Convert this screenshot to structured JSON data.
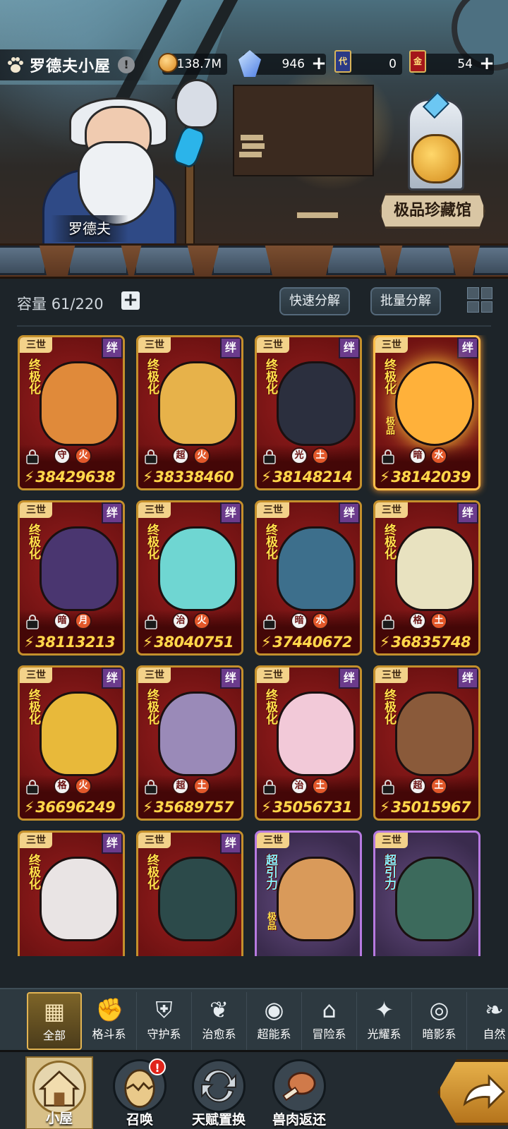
{
  "header": {
    "title": "罗德夫小屋",
    "info_badge": "!",
    "resources": [
      {
        "name": "gold-coin",
        "value": "138.7M",
        "has_plus": false
      },
      {
        "name": "crystal",
        "value": "946",
        "has_plus": true
      },
      {
        "name": "dai-card",
        "icon_text": "代",
        "value": "0",
        "has_plus": false
      },
      {
        "name": "jin-card",
        "icon_text": "金",
        "value": "54",
        "has_plus": true
      }
    ],
    "plus": "+"
  },
  "scene": {
    "npc_name": "罗德夫",
    "collection_label": "极品珍藏馆"
  },
  "inventory": {
    "capacity_label": "容量",
    "capacity_value": "61/220",
    "quick_decompose": "快速分解",
    "batch_decompose": "批量分解"
  },
  "cards": [
    {
      "tier": "三世",
      "bond": "绊",
      "rank": "终极化",
      "quality": "",
      "power": "38429638",
      "el1": "守",
      "el2": "火",
      "art": "#e08a3a",
      "frame": "red"
    },
    {
      "tier": "三世",
      "bond": "绊",
      "rank": "终极化",
      "quality": "",
      "power": "38338460",
      "el1": "超",
      "el2": "火",
      "art": "#e7b24a",
      "frame": "red"
    },
    {
      "tier": "三世",
      "bond": "绊",
      "rank": "终极化",
      "quality": "",
      "power": "38148214",
      "el1": "光",
      "el2": "土",
      "art": "#2b2f3e",
      "frame": "red"
    },
    {
      "tier": "三世",
      "bond": "绊",
      "rank": "终极化",
      "quality": "极品",
      "power": "38142039",
      "el1": "暗",
      "el2": "水",
      "art": "#ffb13a",
      "frame": "gold"
    },
    {
      "tier": "三世",
      "bond": "绊",
      "rank": "终极化",
      "quality": "",
      "power": "38113213",
      "el1": "暗",
      "el2": "月",
      "art": "#4a3670",
      "frame": "red"
    },
    {
      "tier": "三世",
      "bond": "绊",
      "rank": "终极化",
      "quality": "",
      "power": "38040751",
      "el1": "治",
      "el2": "火",
      "art": "#6fd6d2",
      "frame": "red"
    },
    {
      "tier": "三世",
      "bond": "绊",
      "rank": "终极化",
      "quality": "",
      "power": "37440672",
      "el1": "暗",
      "el2": "水",
      "art": "#3d6f8c",
      "frame": "red"
    },
    {
      "tier": "三世",
      "bond": "绊",
      "rank": "终极化",
      "quality": "",
      "power": "36835748",
      "el1": "格",
      "el2": "土",
      "art": "#e8e2c0",
      "frame": "red"
    },
    {
      "tier": "三世",
      "bond": "绊",
      "rank": "终极化",
      "quality": "",
      "power": "36696249",
      "el1": "格",
      "el2": "火",
      "art": "#e8b93a",
      "frame": "red"
    },
    {
      "tier": "三世",
      "bond": "绊",
      "rank": "终极化",
      "quality": "",
      "power": "35689757",
      "el1": "超",
      "el2": "土",
      "art": "#9a8ab8",
      "frame": "red"
    },
    {
      "tier": "三世",
      "bond": "绊",
      "rank": "终极化",
      "quality": "",
      "power": "35056731",
      "el1": "治",
      "el2": "土",
      "art": "#f2c9d8",
      "frame": "red"
    },
    {
      "tier": "三世",
      "bond": "绊",
      "rank": "终极化",
      "quality": "",
      "power": "35015967",
      "el1": "超",
      "el2": "土",
      "art": "#8a5a3a",
      "frame": "red"
    },
    {
      "tier": "三世",
      "bond": "绊",
      "rank": "终极化",
      "quality": "",
      "power": "",
      "el1": "",
      "el2": "",
      "art": "#e9e4e4",
      "frame": "red"
    },
    {
      "tier": "三世",
      "bond": "绊",
      "rank": "终极化",
      "quality": "",
      "power": "",
      "el1": "",
      "el2": "",
      "art": "#2c4a4a",
      "frame": "red"
    },
    {
      "tier": "三世",
      "bond": "",
      "rank": "超引力",
      "quality": "极品",
      "power": "",
      "el1": "",
      "el2": "",
      "art": "#d99a5a",
      "frame": "purple"
    },
    {
      "tier": "三世",
      "bond": "",
      "rank": "超引力",
      "quality": "",
      "power": "",
      "el1": "",
      "el2": "",
      "art": "#3c6a5c",
      "frame": "purple"
    }
  ],
  "filters": [
    {
      "label": "全部",
      "icon": "all-icon",
      "active": true
    },
    {
      "label": "格斗系",
      "icon": "fist-icon",
      "active": false
    },
    {
      "label": "守护系",
      "icon": "shield-icon",
      "active": false
    },
    {
      "label": "治愈系",
      "icon": "sprout-icon",
      "active": false
    },
    {
      "label": "超能系",
      "icon": "psychic-icon",
      "active": false
    },
    {
      "label": "冒险系",
      "icon": "lantern-icon",
      "active": false
    },
    {
      "label": "光耀系",
      "icon": "star-icon",
      "active": false
    },
    {
      "label": "暗影系",
      "icon": "eye-icon",
      "active": false
    },
    {
      "label": "自然",
      "icon": "leaf-icon",
      "active": false
    }
  ],
  "nav": [
    {
      "label": "小屋",
      "icon": "house-icon",
      "active": true
    },
    {
      "label": "召唤",
      "icon": "egg-icon",
      "active": false,
      "alert": "!"
    },
    {
      "label": "天赋置换",
      "icon": "swap-icon",
      "active": false
    },
    {
      "label": "兽肉返还",
      "icon": "meat-icon",
      "active": false
    }
  ]
}
